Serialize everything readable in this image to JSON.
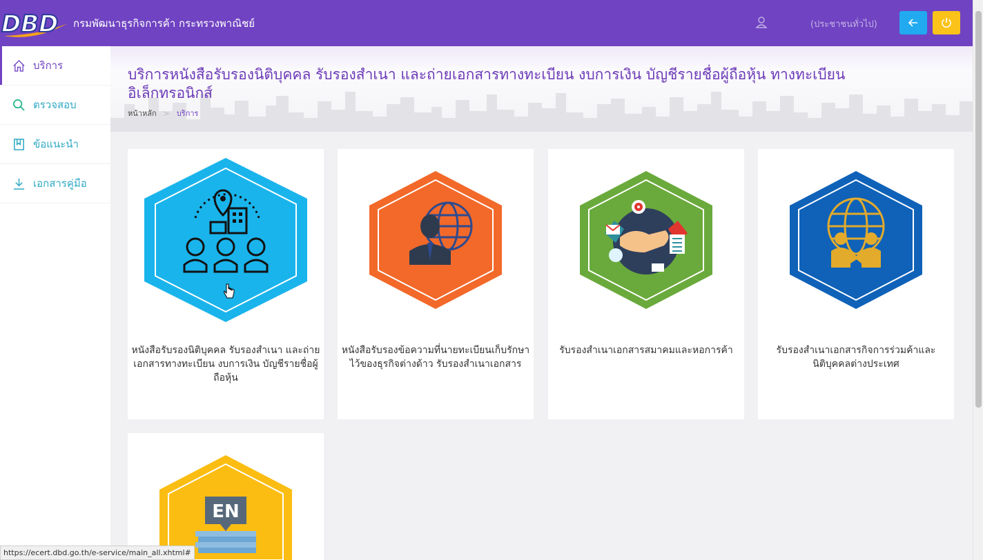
{
  "header": {
    "logo_text": "DBD",
    "org_name": "กรมพัฒนาธุรกิจการค้า กระทรวงพาณิชย์",
    "user_role": "(ประชาชนทั่วไป)",
    "user_icon": "user-icon",
    "back_icon": "arrow-left-icon",
    "power_icon": "power-icon"
  },
  "sidebar": {
    "items": [
      {
        "label": "บริการ",
        "icon": "home-icon",
        "active": true
      },
      {
        "label": "ตรวจสอบ",
        "icon": "search-icon",
        "active": false
      },
      {
        "label": "ข้อแนะนำ",
        "icon": "book-icon",
        "active": false
      },
      {
        "label": "เอกสารคู่มือ",
        "icon": "download-icon",
        "active": false
      }
    ]
  },
  "page": {
    "title": "บริการหนังสือรับรองนิติบุคคล รับรองสำเนา และถ่ายเอกสารทางทะเบียน งบการเงิน บัญชีรายชื่อผู้ถือหุ้น ทางทะเบียนอิเล็กทรอนิกส์",
    "breadcrumb": {
      "home": "หน้าหลัก",
      "separator": ">",
      "current": "บริการ"
    }
  },
  "services": [
    {
      "label": "หนังสือรับรองนิติบุคคล รับรองสำเนา และถ่ายเอกสารทางทะเบียน งบการเงิน บัญชีรายชื่อผู้ถือหุ้น",
      "color": "#1ab4ec",
      "icon": "location-people-icon"
    },
    {
      "label": "หนังสือรับรองข้อความที่นายทะเบียนเก็บรักษาไว้ของธุรกิจต่างด้าว รับรองสำเนาเอกสาร",
      "color": "#f2692a",
      "icon": "foreign-business-icon"
    },
    {
      "label": "รับรองสำเนาเอกสารสมาคมและหอการค้า",
      "color": "#6aaa3c",
      "icon": "handshake-icon"
    },
    {
      "label": "รับรองสำเนาเอกสารกิจการร่วมค้าและนิติบุคคลต่างประเทศ",
      "color": "#0f62b8",
      "icon": "global-partners-icon"
    },
    {
      "label": "",
      "color": "#fbbd12",
      "icon": "en-document-icon",
      "badge": "EN"
    }
  ],
  "status_bar": {
    "url": "https://ecert.dbd.go.th/e-service/main_all.xhtml#"
  },
  "colors": {
    "header_bg": "#7043c2",
    "sidebar_accent": "#2fa9c3",
    "back_button": "#21aaf0",
    "power_button": "#fbc21a"
  }
}
